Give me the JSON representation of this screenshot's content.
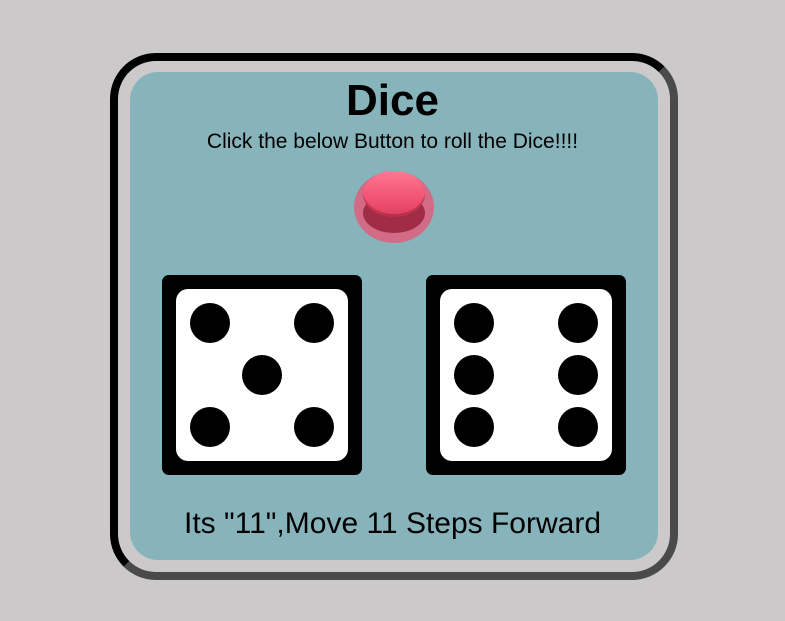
{
  "game": {
    "title": "Dice",
    "instruction": "Click the below Button to roll the Dice!!!!",
    "result_text": "Its \"11\",Move 11 Steps Forward"
  },
  "dice": [
    {
      "label": "die-1",
      "value": 5
    },
    {
      "label": "die-2",
      "value": 6
    }
  ],
  "colors": {
    "background": "#cbc9ca",
    "panel": "#87b3bb",
    "button": "#f0506f",
    "button_halo": "#d16b86"
  },
  "icons": {
    "roll_button": "red-push-button"
  }
}
